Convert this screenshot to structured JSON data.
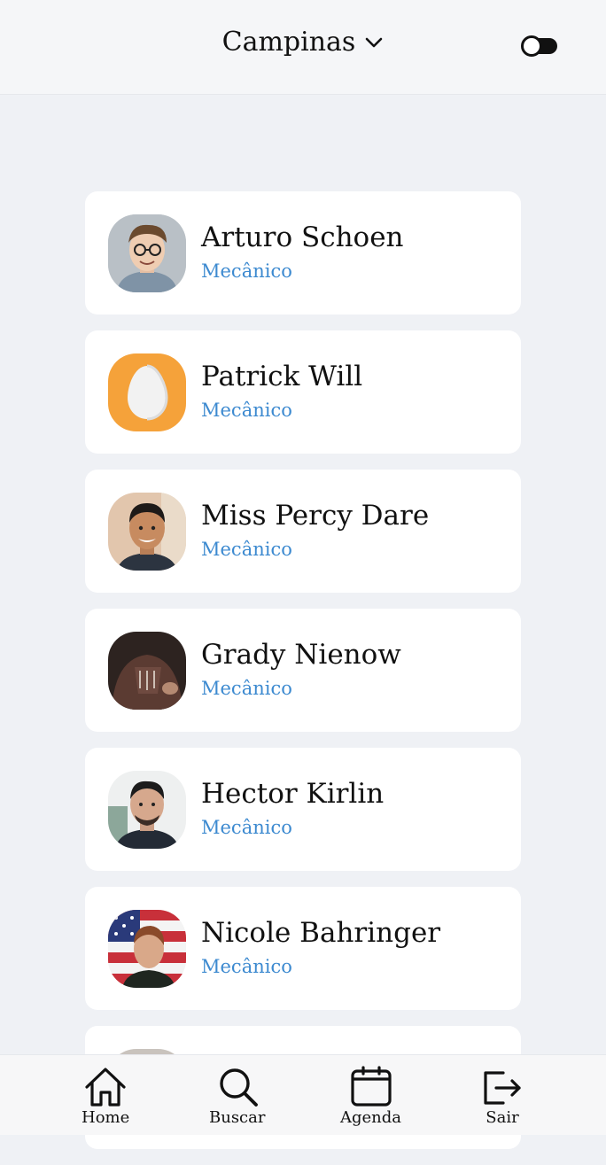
{
  "header": {
    "city": "Campinas",
    "city_dropdown_icon": "chevron-down-icon",
    "theme_toggle_icon": "toggle-icon"
  },
  "barbers": [
    {
      "name": "Arturo Schoen",
      "role": "Mecânico",
      "avatar": "person-glasses"
    },
    {
      "name": "Patrick Will",
      "role": "Mecânico",
      "avatar": "default-egg"
    },
    {
      "name": "Miss Percy Dare",
      "role": "Mecânico",
      "avatar": "person-smiling"
    },
    {
      "name": "Grady Nienow",
      "role": "Mecânico",
      "avatar": "person-hoodie"
    },
    {
      "name": "Hector Kirlin",
      "role": "Mecânico",
      "avatar": "person-dark-hair"
    },
    {
      "name": "Nicole Bahringer",
      "role": "Mecânico",
      "avatar": "person-flag"
    }
  ],
  "nav": {
    "home": "Home",
    "search": "Buscar",
    "agenda": "Agenda",
    "logout": "Sair"
  },
  "colors": {
    "accent": "#3d8ad0",
    "egg_orange": "#f5a23a",
    "background": "#eff1f5"
  }
}
